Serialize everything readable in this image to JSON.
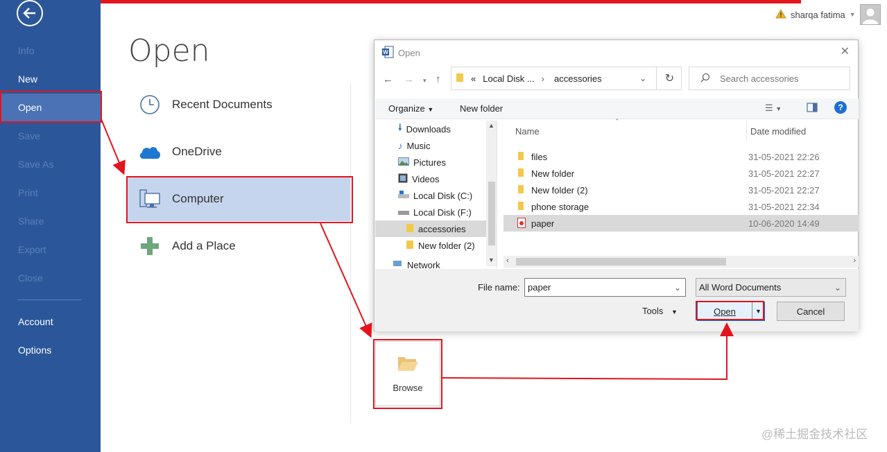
{
  "sidebar": {
    "items": [
      {
        "label": "Info"
      },
      {
        "label": "New"
      },
      {
        "label": "Open"
      },
      {
        "label": "Save"
      },
      {
        "label": "Save As"
      },
      {
        "label": "Print"
      },
      {
        "label": "Share"
      },
      {
        "label": "Export"
      },
      {
        "label": "Close"
      },
      {
        "label": "Account"
      },
      {
        "label": "Options"
      }
    ]
  },
  "main": {
    "title": "Open",
    "places": [
      {
        "label": "Recent Documents",
        "icon": "clock-icon"
      },
      {
        "label": "OneDrive",
        "icon": "cloud-icon"
      },
      {
        "label": "Computer",
        "icon": "computer-icon"
      },
      {
        "label": "Add a Place",
        "icon": "plus-icon"
      }
    ],
    "browse_label": "Browse"
  },
  "user": {
    "name": "sharqa fatima"
  },
  "dialog": {
    "title": "Open",
    "path": {
      "prefix": "«",
      "segment1": "Local Disk ...",
      "separator": "›",
      "segment2": "accessories"
    },
    "search_placeholder": "Search accessories",
    "organize_label": "Organize",
    "new_folder_label": "New folder",
    "tree": [
      {
        "label": "Downloads",
        "icon": "download-icon"
      },
      {
        "label": "Music",
        "icon": "music-icon"
      },
      {
        "label": "Pictures",
        "icon": "pictures-icon"
      },
      {
        "label": "Videos",
        "icon": "videos-icon"
      },
      {
        "label": "Local Disk (C:)",
        "icon": "disk-icon"
      },
      {
        "label": "Local Disk (F:)",
        "icon": "disk-icon"
      },
      {
        "label": "accessories",
        "icon": "folder-icon"
      },
      {
        "label": "New folder (2)",
        "icon": "folder-icon"
      },
      {
        "label": "Network",
        "icon": "network-icon"
      }
    ],
    "columns": {
      "name": "Name",
      "date": "Date modified"
    },
    "files": [
      {
        "name": "files",
        "date": "31-05-2021 22:26",
        "icon": "folder-icon"
      },
      {
        "name": "New folder",
        "date": "31-05-2021 22:27",
        "icon": "folder-icon"
      },
      {
        "name": "New folder (2)",
        "date": "31-05-2021 22:27",
        "icon": "folder-icon"
      },
      {
        "name": "phone storage",
        "date": "31-05-2021 22:34",
        "icon": "folder-icon"
      },
      {
        "name": "paper",
        "date": "10-06-2020 14:49",
        "icon": "pdf-icon"
      }
    ],
    "filename_label": "File name:",
    "filename_value": "paper",
    "filetype_value": "All Word Documents",
    "tools_label": "Tools",
    "open_label": "Open",
    "cancel_label": "Cancel"
  },
  "watermark": "@稀土掘金技术社区",
  "colors": {
    "sidebar": "#2b579a",
    "selected_place": "#c5d5ee",
    "annotation": "#e3141c"
  }
}
